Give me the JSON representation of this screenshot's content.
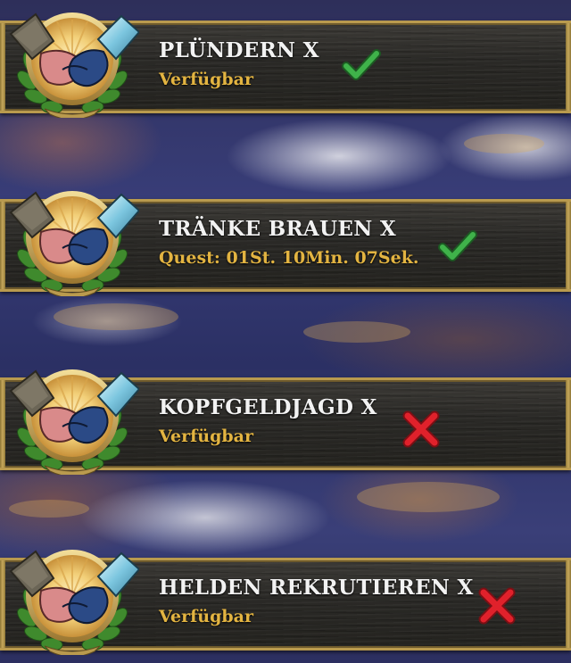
{
  "missions": [
    {
      "title": "PLÜNDERN X",
      "status": "Verfügbar",
      "state_icon": "check-icon",
      "state_color": "#3fb24a"
    },
    {
      "title": "TRÄNKE BRAUEN X",
      "status": "Quest: 01St. 10Min. 07Sek.",
      "state_icon": "check-icon",
      "state_color": "#3fb24a"
    },
    {
      "title": "KOPFGELDJAGD X",
      "status": "Verfügbar",
      "state_icon": "cross-icon",
      "state_color": "#e0212b"
    },
    {
      "title": "HELDEN REKRUTIEREN X",
      "status": "Verfügbar",
      "state_icon": "cross-icon",
      "state_color": "#e0212b"
    }
  ],
  "colors": {
    "frame_gold": "#b99a4e",
    "status_gold": "#e3b441",
    "wood_dark": "#2a2926"
  }
}
